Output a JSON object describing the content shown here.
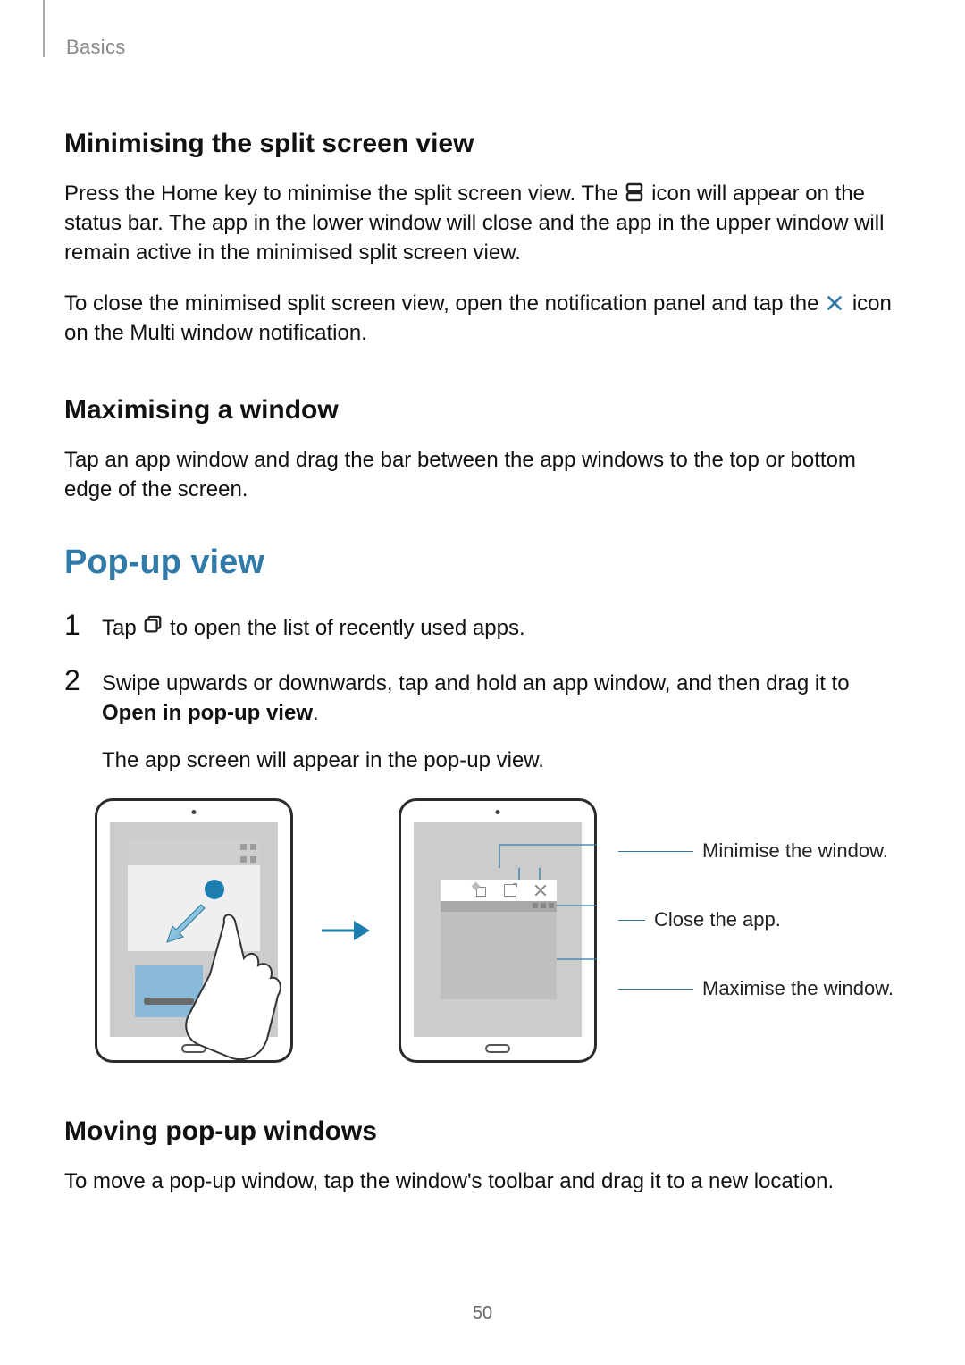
{
  "breadcrumb": "Basics",
  "sections": {
    "minimise_title": "Minimising the split screen view",
    "minimise_p1a": "Press the Home key to minimise the split screen view. The ",
    "minimise_p1b": " icon will appear on the status bar. The app in the lower window will close and the app in the upper window will remain active in the minimised split screen view.",
    "minimise_p2a": "To close the minimised split screen view, open the notification panel and tap the ",
    "minimise_p2b": " icon on the Multi window notification.",
    "maximise_title": "Maximising a window",
    "maximise_p1": "Tap an app window and drag the bar between the app windows to the top or bottom edge of the screen.",
    "popup_title": "Pop-up view",
    "step1_a": "Tap ",
    "step1_b": " to open the list of recently used apps.",
    "step2_a": "Swipe upwards or downwards, tap and hold an app window, and then drag it to ",
    "step2_bold": "Open in pop-up view",
    "step2_c": ".",
    "step2_sub": "The app screen will appear in the pop-up view.",
    "callout_minimise": "Minimise the window.",
    "callout_close": "Close the app.",
    "callout_maximise": "Maximise the window.",
    "moving_title": "Moving pop-up windows",
    "moving_p1": "To move a pop-up window, tap the window's toolbar and drag it to a new location."
  },
  "nums": {
    "one": "1",
    "two": "2"
  },
  "page_number": "50",
  "icons": {
    "split": "split-screen-icon",
    "close_x": "close-x-icon",
    "recents": "recents-icon"
  }
}
